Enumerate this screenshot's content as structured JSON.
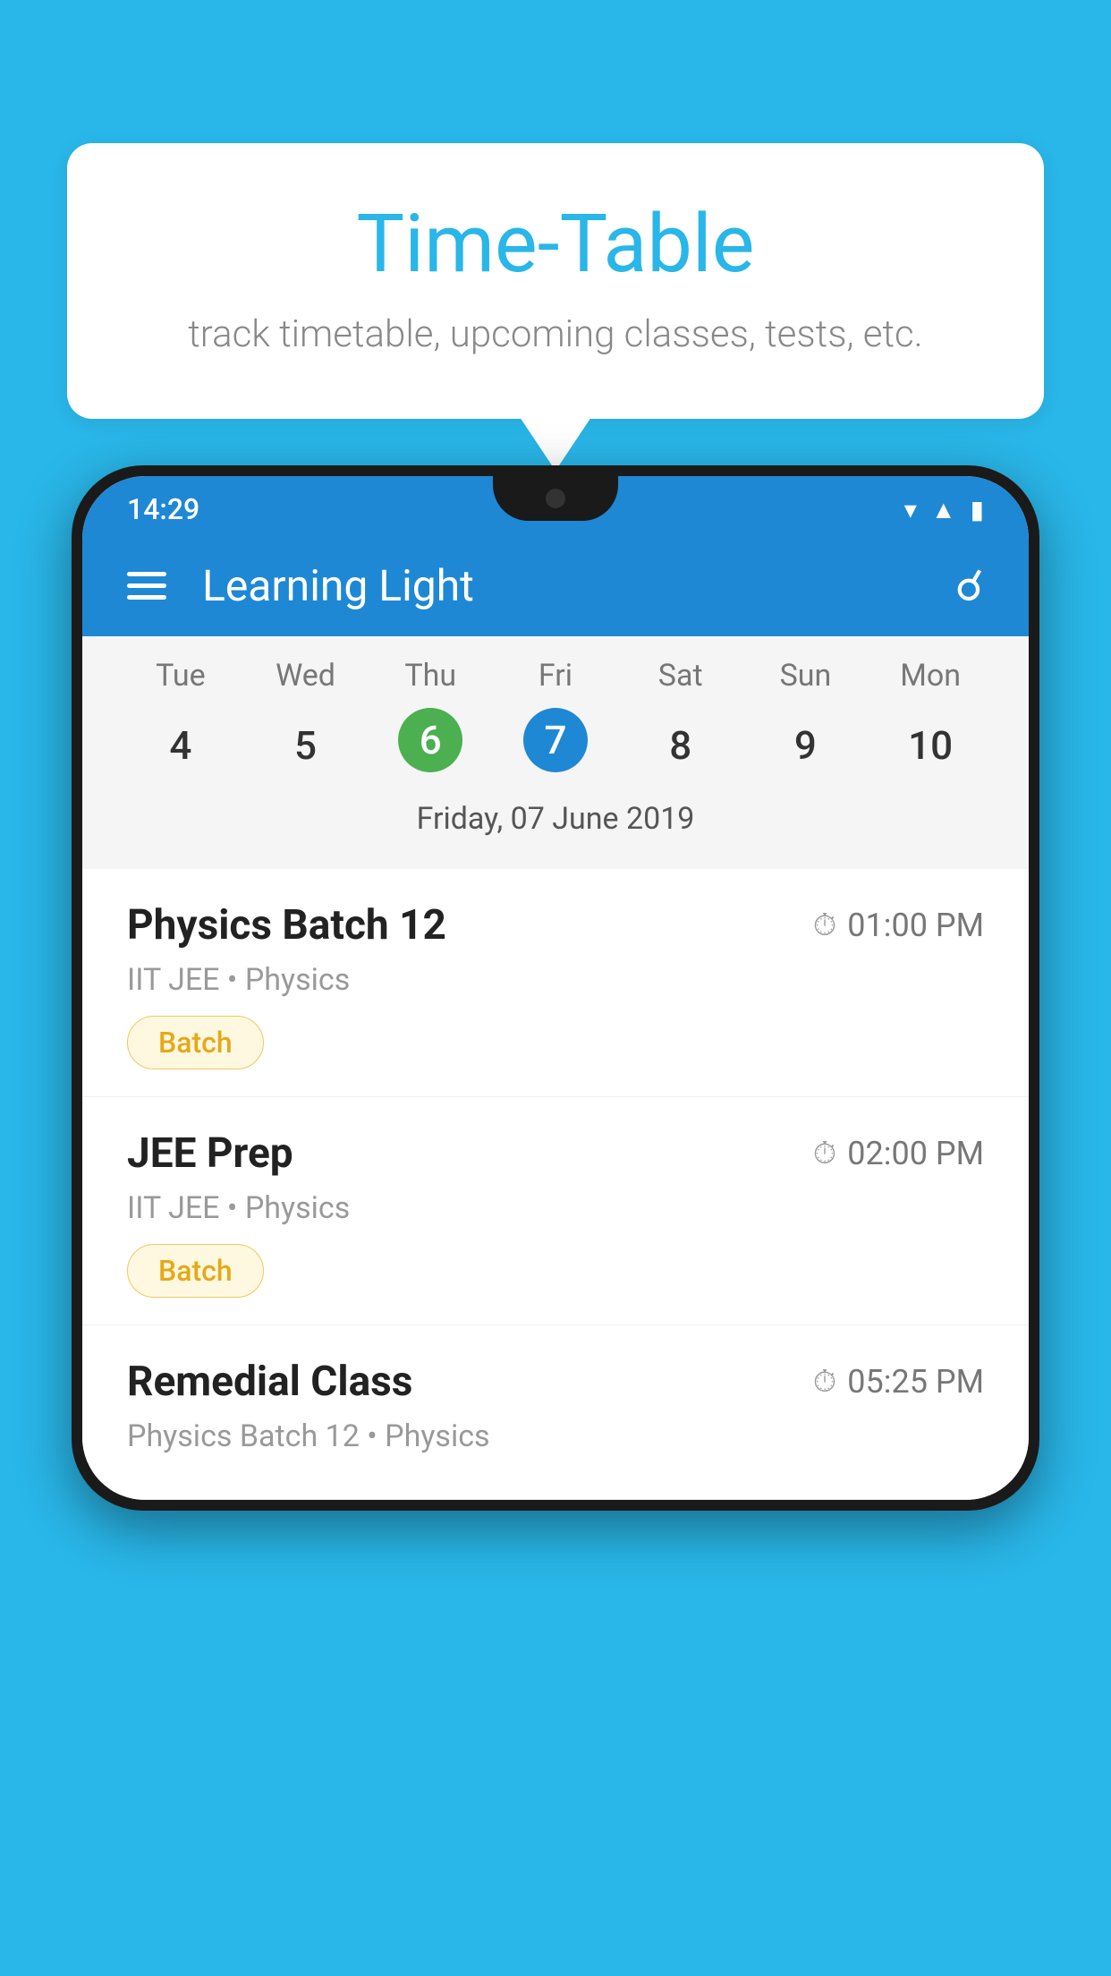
{
  "background_color": "#29b6e8",
  "speech_bubble": {
    "title": "Time-Table",
    "subtitle": "track timetable, upcoming classes, tests, etc."
  },
  "phone": {
    "status_bar": {
      "time": "14:29"
    },
    "app_bar": {
      "title": "Learning Light"
    },
    "calendar": {
      "days": [
        "Tue",
        "Wed",
        "Thu",
        "Fri",
        "Sat",
        "Sun",
        "Mon"
      ],
      "dates": [
        "4",
        "5",
        "6",
        "7",
        "8",
        "9",
        "10"
      ],
      "today_index": 2,
      "selected_index": 3,
      "selected_label": "Friday, 07 June 2019"
    },
    "schedule": [
      {
        "title": "Physics Batch 12",
        "time": "01:00 PM",
        "subtitle": "IIT JEE • Physics",
        "tag": "Batch"
      },
      {
        "title": "JEE Prep",
        "time": "02:00 PM",
        "subtitle": "IIT JEE • Physics",
        "tag": "Batch"
      },
      {
        "title": "Remedial Class",
        "time": "05:25 PM",
        "subtitle": "Physics Batch 12 • Physics",
        "tag": ""
      }
    ]
  }
}
